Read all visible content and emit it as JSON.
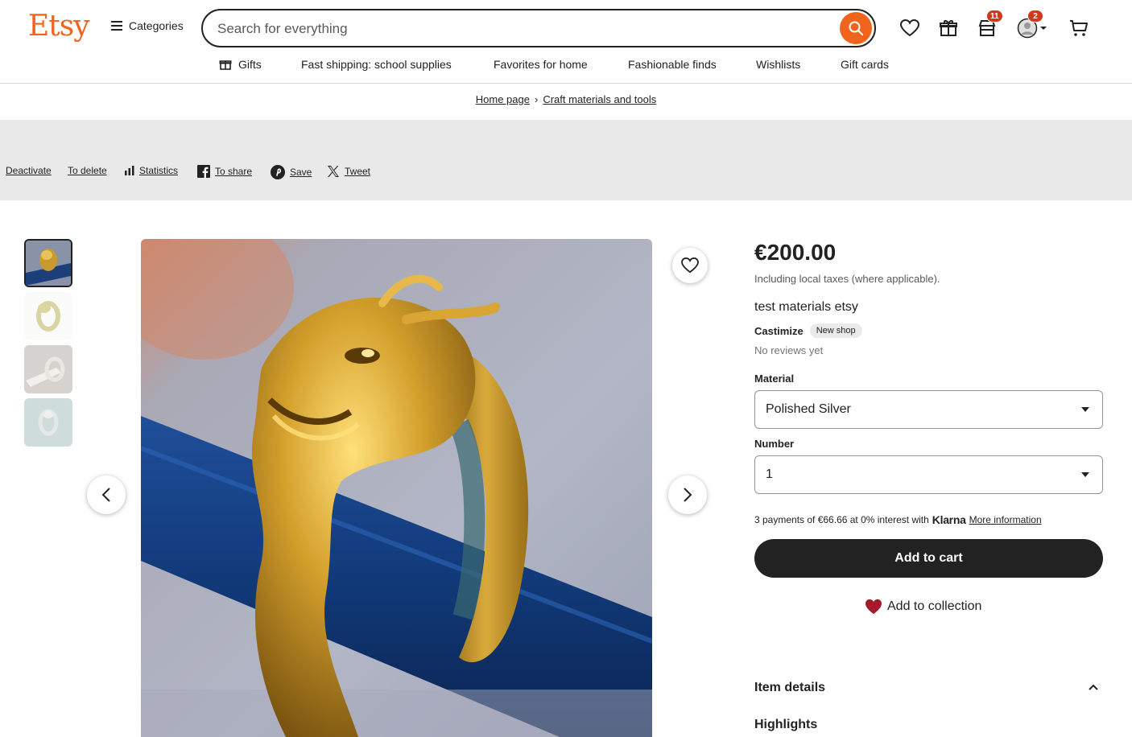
{
  "header": {
    "logo": "Etsy",
    "categories_label": "Categories",
    "search_placeholder": "Search for everything",
    "cart_badge_gifts": "11",
    "account_badge": "2"
  },
  "nav": {
    "items": [
      {
        "label": "Gifts"
      },
      {
        "label": "Fast shipping: school supplies"
      },
      {
        "label": "Favorites for home"
      },
      {
        "label": "Fashionable finds"
      },
      {
        "label": "Wishlists"
      },
      {
        "label": "Gift cards"
      }
    ]
  },
  "breadcrumb": {
    "home": "Home page",
    "category": "Craft materials and tools"
  },
  "admin": {
    "deactivate": "Deactivate",
    "delete": "To delete",
    "statistics": "Statistics",
    "share": "To share",
    "save": "Save",
    "tweet": "Tweet"
  },
  "product": {
    "price": "€200.00",
    "tax_note": "Including local taxes (where applicable).",
    "title": "test materials etsy",
    "shop_name": "Castimize",
    "shop_badge": "New shop",
    "reviews": "No reviews yet",
    "material_label": "Material",
    "material_value": "Polished Silver",
    "number_label": "Number",
    "number_value": "1",
    "klarna_text": "3 payments of €66.66 at 0% interest with",
    "klarna_brand": "Klarna",
    "klarna_link": "More information",
    "add_to_cart": "Add to cart",
    "add_to_collection": "Add to collection",
    "item_details": "Item details",
    "highlights": "Highlights"
  },
  "colors": {
    "brand": "#f1641e",
    "badge": "#d03a1c",
    "button_dark": "#222222",
    "heart": "#a61a2e"
  }
}
